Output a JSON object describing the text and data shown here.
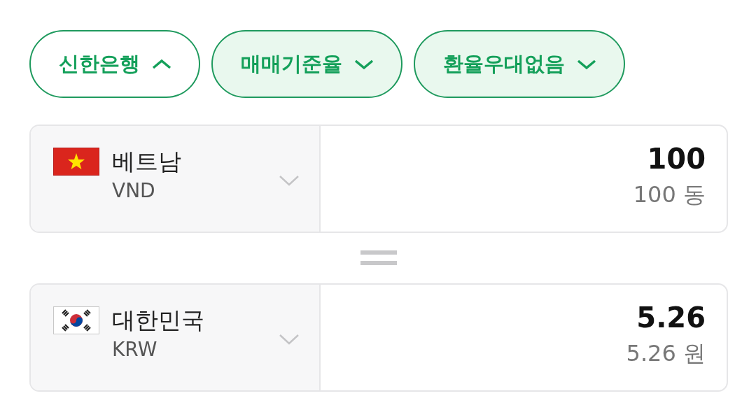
{
  "filters": [
    {
      "label": "신한은행",
      "expanded": true
    },
    {
      "label": "매매기준율",
      "expanded": false
    },
    {
      "label": "환율우대없음",
      "expanded": false
    }
  ],
  "converters": [
    {
      "country": "베트남",
      "code": "VND",
      "amount": "100",
      "amount_text": "100 동"
    },
    {
      "country": "대한민국",
      "code": "KRW",
      "amount": "5.26",
      "amount_text": "5.26 원"
    }
  ]
}
